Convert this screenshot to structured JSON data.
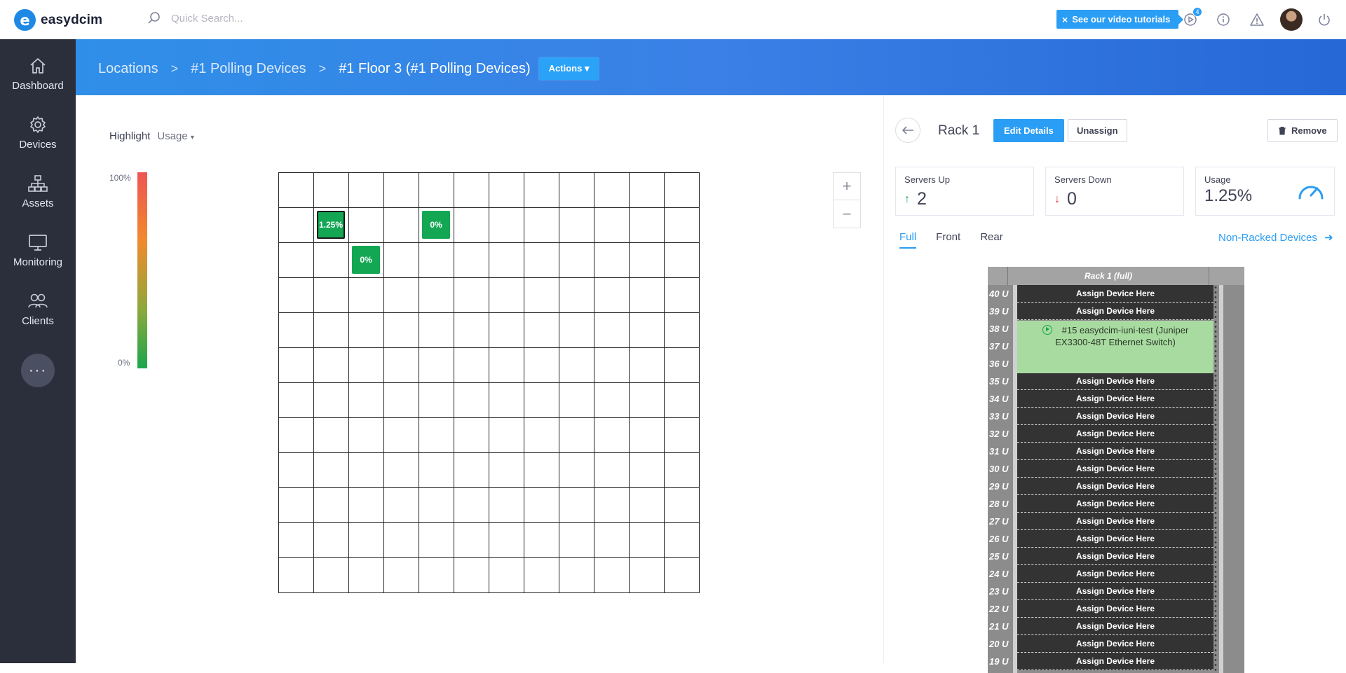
{
  "app": {
    "logo_letter": "e",
    "logo_text": "easydcim"
  },
  "topbar": {
    "search_placeholder": "Quick Search...",
    "tutorials_label": "See our video tutorials",
    "tutorials_close": "×",
    "notifications_count": "4"
  },
  "sidebar": {
    "items": [
      {
        "label": "Dashboard",
        "icon": "home-icon"
      },
      {
        "label": "Devices",
        "icon": "gear-icon"
      },
      {
        "label": "Assets",
        "icon": "sitemap-icon"
      },
      {
        "label": "Monitoring",
        "icon": "monitor-icon"
      },
      {
        "label": "Clients",
        "icon": "users-icon"
      }
    ],
    "more_label": "···"
  },
  "breadcrumb": {
    "items": [
      "Locations",
      "#1 Polling Devices",
      "#1 Floor 3 (#1 Polling Devices)"
    ],
    "separator": ">",
    "actions_label": "Actions ▾"
  },
  "floor": {
    "highlight_label": "Highlight",
    "highlight_value": "Usage",
    "legend_max": "100%",
    "legend_min": "0%",
    "tiles": [
      {
        "row": 1,
        "col": 1,
        "label": "1.25%",
        "selected": true
      },
      {
        "row": 1,
        "col": 4,
        "label": "0%",
        "selected": false
      },
      {
        "row": 2,
        "col": 2,
        "label": "0%",
        "selected": false
      }
    ],
    "zoom_in": "+",
    "zoom_out": "−"
  },
  "panel": {
    "back_icon": "arrow-left-icon",
    "title": "Rack 1",
    "edit_label": "Edit Details",
    "unassign_label": "Unassign",
    "remove_label": "Remove",
    "stats": {
      "servers_up_label": "Servers Up",
      "servers_up_value": "2",
      "servers_down_label": "Servers Down",
      "servers_down_value": "0",
      "usage_label": "Usage",
      "usage_value": "1.25%"
    },
    "tabs": [
      "Full",
      "Front",
      "Rear"
    ],
    "active_tab": "Full",
    "non_racked_label": "Non-Racked Devices",
    "rack": {
      "header": "Rack 1 (full)",
      "units": [
        "40 U",
        "39 U",
        "38 U",
        "37 U",
        "36 U",
        "35 U",
        "34 U",
        "33 U",
        "32 U",
        "31 U",
        "30 U",
        "29 U",
        "28 U",
        "27 U",
        "26 U",
        "25 U",
        "24 U",
        "23 U",
        "22 U",
        "21 U",
        "20 U",
        "19 U"
      ],
      "assign_label": "Assign Device Here",
      "device_label": "#15 easydcim-iuni-test (Juniper EX3300-48T Ethernet Switch)"
    }
  },
  "colors": {
    "accent": "#2a9df4",
    "sidebar": "#2b2f3c",
    "tile_green": "#13a754"
  }
}
